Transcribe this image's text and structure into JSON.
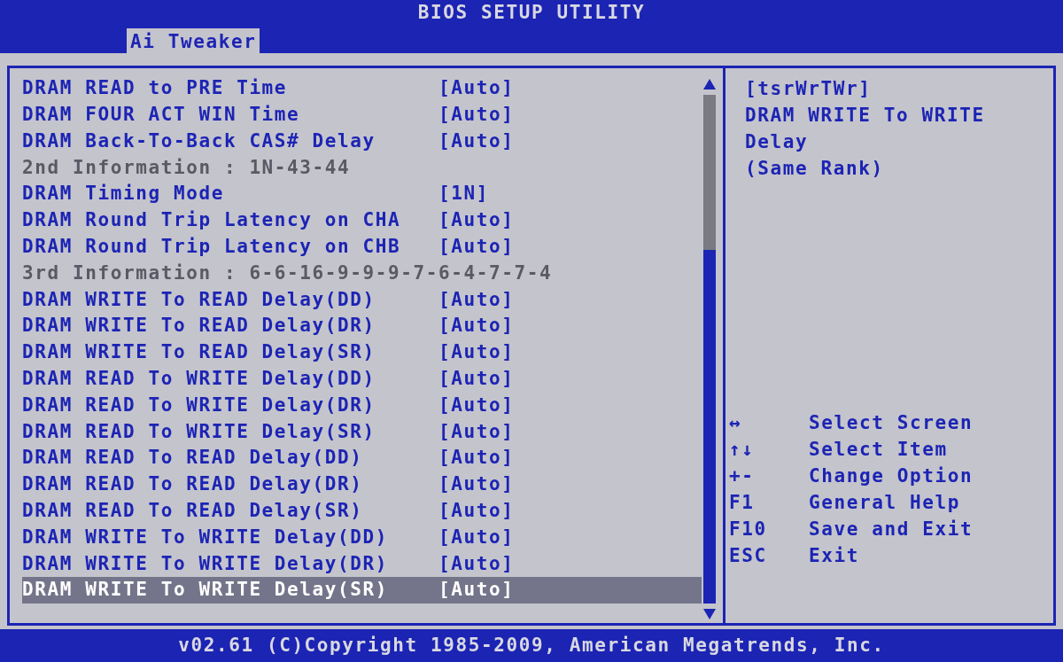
{
  "window": {
    "title": "BIOS SETUP UTILITY"
  },
  "tabs": [
    {
      "label": "Ai Tweaker",
      "selected": true
    }
  ],
  "settings": [
    {
      "kind": "setting",
      "label": "DRAM READ to PRE Time",
      "value": "[Auto]",
      "selected": false
    },
    {
      "kind": "setting",
      "label": "DRAM FOUR ACT WIN Time",
      "value": "[Auto]",
      "selected": false
    },
    {
      "kind": "setting",
      "label": "DRAM Back-To-Back CAS# Delay",
      "value": "[Auto]",
      "selected": false
    },
    {
      "kind": "info",
      "label": "2nd Information : 1N-43-44",
      "selected": false
    },
    {
      "kind": "setting",
      "label": "DRAM Timing Mode",
      "value": "[1N]",
      "selected": false
    },
    {
      "kind": "setting",
      "label": "DRAM Round Trip Latency on CHA",
      "value": "[Auto]",
      "selected": false
    },
    {
      "kind": "setting",
      "label": "DRAM Round Trip Latency on CHB",
      "value": "[Auto]",
      "selected": false
    },
    {
      "kind": "info",
      "label": "3rd Information : 6-6-16-9-9-9-7-6-4-7-7-4",
      "selected": false
    },
    {
      "kind": "setting",
      "label": "DRAM WRITE To READ Delay(DD)",
      "value": "[Auto]",
      "selected": false
    },
    {
      "kind": "setting",
      "label": "DRAM WRITE To READ Delay(DR)",
      "value": "[Auto]",
      "selected": false
    },
    {
      "kind": "setting",
      "label": "DRAM WRITE To READ Delay(SR)",
      "value": "[Auto]",
      "selected": false
    },
    {
      "kind": "setting",
      "label": "DRAM READ To WRITE Delay(DD)",
      "value": "[Auto]",
      "selected": false
    },
    {
      "kind": "setting",
      "label": "DRAM READ To WRITE Delay(DR)",
      "value": "[Auto]",
      "selected": false
    },
    {
      "kind": "setting",
      "label": "DRAM READ To WRITE Delay(SR)",
      "value": "[Auto]",
      "selected": false
    },
    {
      "kind": "setting",
      "label": "DRAM READ To READ Delay(DD)",
      "value": "[Auto]",
      "selected": false
    },
    {
      "kind": "setting",
      "label": "DRAM READ To READ Delay(DR)",
      "value": "[Auto]",
      "selected": false
    },
    {
      "kind": "setting",
      "label": "DRAM READ To READ Delay(SR)",
      "value": "[Auto]",
      "selected": false
    },
    {
      "kind": "setting",
      "label": "DRAM WRITE To WRITE Delay(DD)",
      "value": "[Auto]",
      "selected": false
    },
    {
      "kind": "setting",
      "label": "DRAM WRITE To WRITE Delay(DR)",
      "value": "[Auto]",
      "selected": false
    },
    {
      "kind": "setting",
      "label": "DRAM WRITE To WRITE Delay(SR)",
      "value": "[Auto]",
      "selected": true
    }
  ],
  "help": {
    "lines": [
      "[tsrWrTWr]",
      "DRAM WRITE To WRITE",
      "Delay",
      "(Same Rank)"
    ],
    "keys": [
      {
        "key": "↔",
        "action": "Select Screen"
      },
      {
        "key": "↑↓",
        "action": "Select Item"
      },
      {
        "key": "+-",
        "action": "Change Option"
      },
      {
        "key": "F1",
        "action": "General Help"
      },
      {
        "key": "F10",
        "action": "Save and Exit"
      },
      {
        "key": "ESC",
        "action": "Exit"
      }
    ]
  },
  "status_bar": "v02.61 (C)Copyright 1985-2009, American Megatrends, Inc."
}
